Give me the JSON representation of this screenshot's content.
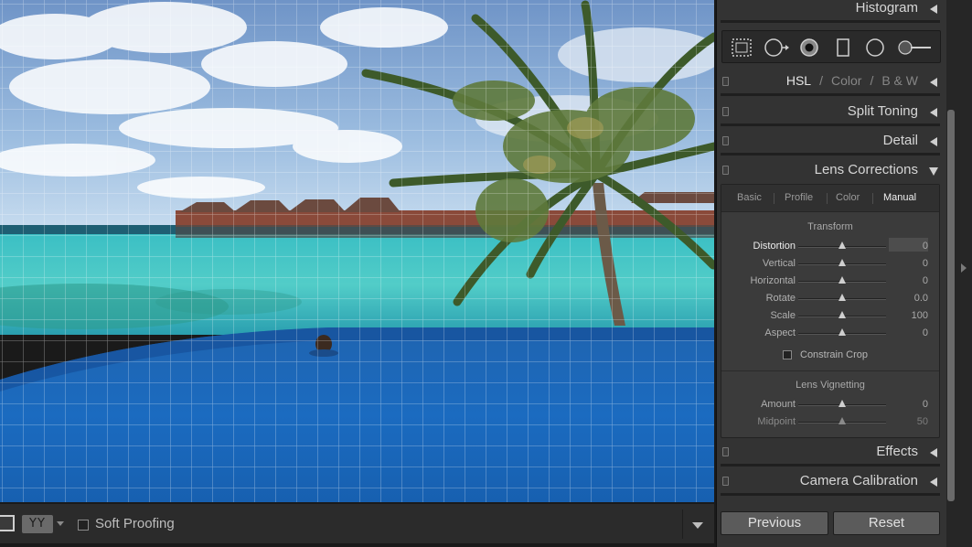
{
  "toolbar": {
    "yy_label": "YY",
    "soft_proofing_label": "Soft Proofing"
  },
  "panel": {
    "sections": {
      "histogram": "Histogram",
      "hsl": {
        "hsl": "HSL",
        "color": "Color",
        "bw": "B & W"
      },
      "split_toning": "Split Toning",
      "detail": "Detail",
      "lens_corrections": "Lens Corrections",
      "effects": "Effects",
      "camera_calibration": "Camera Calibration"
    },
    "tools": [
      "crop-overlay-icon",
      "spot-removal-icon",
      "red-eye-icon",
      "graduated-filter-icon",
      "radial-filter-icon",
      "adjustment-brush-icon"
    ],
    "lens_tabs": [
      "Basic",
      "Profile",
      "Color",
      "Manual"
    ],
    "lens_active_tab": "Manual",
    "transform": {
      "title": "Transform",
      "sliders": [
        {
          "label": "Distortion",
          "value": "0"
        },
        {
          "label": "Vertical",
          "value": "0"
        },
        {
          "label": "Horizontal",
          "value": "0"
        },
        {
          "label": "Rotate",
          "value": "0.0"
        },
        {
          "label": "Scale",
          "value": "100"
        },
        {
          "label": "Aspect",
          "value": "0"
        }
      ],
      "constrain_crop": "Constrain Crop"
    },
    "vignetting": {
      "title": "Lens Vignetting",
      "sliders": [
        {
          "label": "Amount",
          "value": "0"
        },
        {
          "label": "Midpoint",
          "value": "50"
        }
      ]
    },
    "buttons": {
      "previous": "Previous",
      "reset": "Reset"
    }
  }
}
